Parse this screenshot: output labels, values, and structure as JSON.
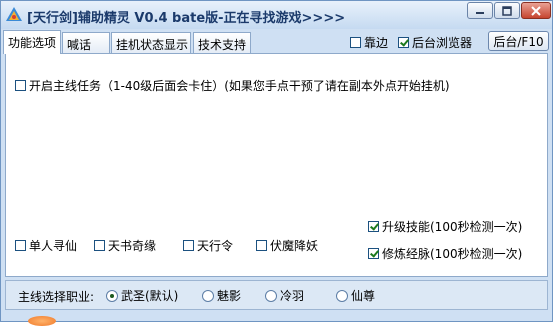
{
  "window": {
    "title": "[天行剑]辅助精灵 V0.4 bate版-正在寻找游戏>>>>"
  },
  "tabs": [
    {
      "label": "功能选项",
      "active": true
    },
    {
      "label": "喊话",
      "active": false
    },
    {
      "label": "挂机状态显示",
      "active": false
    },
    {
      "label": "技术支持",
      "active": false
    }
  ],
  "toolbar": {
    "dock_label": "靠边",
    "dock_checked": false,
    "bg_browser_label": "后台浏览器",
    "bg_browser_checked": true,
    "bg_button_label": "后台/F10"
  },
  "main": {
    "main_quest_label": "开启主线任务（1-40级后面会卡住）(如果您手点干预了请在副本外点开始挂机)",
    "main_quest_checked": false,
    "upgrade_skill_label": "升级技能(100秒检测一次)",
    "upgrade_skill_checked": true,
    "train_meridian_label": "修炼经脉(100秒检测一次)",
    "train_meridian_checked": true,
    "options": [
      {
        "label": "单人寻仙",
        "checked": false
      },
      {
        "label": "天书奇缘",
        "checked": false
      },
      {
        "label": "天行令",
        "checked": false
      },
      {
        "label": "伏魔降妖",
        "checked": false
      }
    ]
  },
  "career": {
    "label": "主线选择职业:",
    "options": [
      "武圣(默认)",
      "魅影",
      "冷羽",
      "仙尊"
    ],
    "selected": "武圣(默认)"
  }
}
